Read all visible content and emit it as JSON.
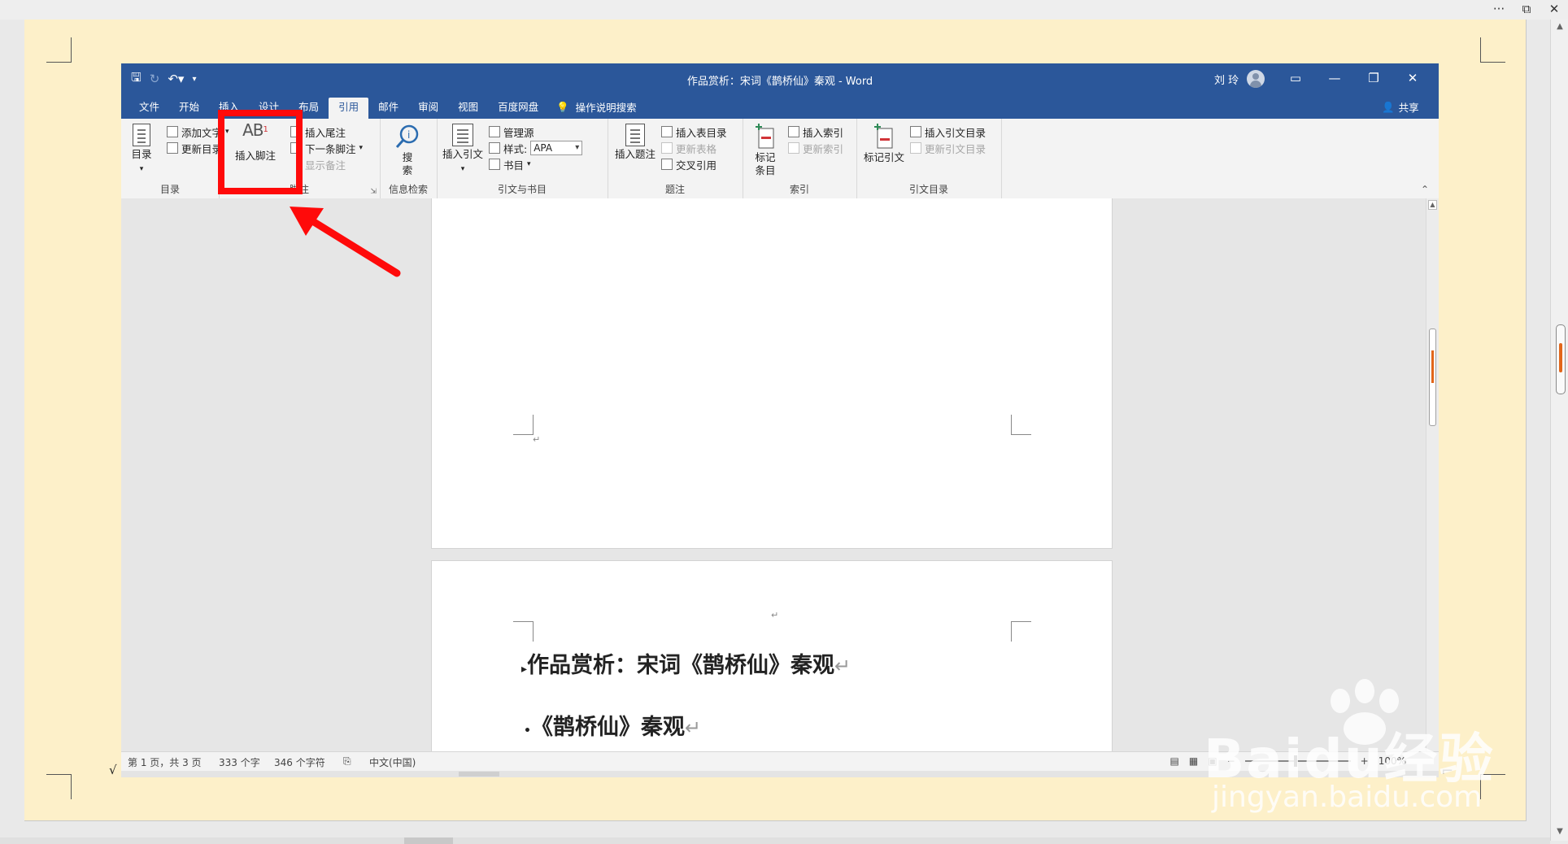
{
  "window": {
    "doc_title": "作品赏析：宋词《鹊桥仙》秦观 - Word",
    "user_name": "刘 玲"
  },
  "tabs": [
    "文件",
    "开始",
    "插入",
    "设计",
    "布局",
    "引用",
    "邮件",
    "审阅",
    "视图",
    "百度网盘"
  ],
  "active_tab": "引用",
  "tell_me": "操作说明搜索",
  "share": "共享",
  "ribbon": {
    "toc": {
      "big": "目录",
      "add_text": "添加文字",
      "update_table": "更新目录",
      "label": "目录"
    },
    "footnotes": {
      "insert_footnote": "插入脚注",
      "insert_endnote": "插入尾注",
      "next_footnote": "下一条脚注",
      "show_notes": "显示备注",
      "label": "脚注"
    },
    "research": {
      "search_top": "搜",
      "search_bottom": "索",
      "label": "信息检索"
    },
    "citations": {
      "insert_citation": "插入引文",
      "manage_sources": "管理源",
      "style_label": "样式:",
      "style_value": "APA",
      "bibliography": "书目",
      "label": "引文与书目"
    },
    "captions": {
      "insert_caption": "插入题注",
      "insert_tof": "插入表目录",
      "update_table": "更新表格",
      "cross_ref": "交叉引用",
      "label": "题注"
    },
    "index": {
      "mark_entry_top": "标记",
      "mark_entry_bottom": "条目",
      "insert_index": "插入索引",
      "update_index": "更新索引",
      "label": "索引"
    },
    "toa": {
      "mark_citation": "标记引文",
      "insert_toa": "插入引文目录",
      "update_toa": "更新引文目录",
      "label": "引文目录"
    }
  },
  "document": {
    "heading1": "作品赏析：宋词《鹊桥仙》秦观",
    "heading2": "《鹊桥仙》秦观",
    "para_mark": "↵"
  },
  "status": {
    "page": "第 1 页，共 3 页",
    "words": "333 个字",
    "chars": "346 个字符",
    "lang": "中文(中国)",
    "zoom": "100%"
  },
  "watermark": {
    "main": "Baidu经验",
    "sub": "jingyan.baidu.com"
  },
  "colors": {
    "word_blue": "#2b579a",
    "highlight_red": "#ff0a0a",
    "outer_page": "#fdf0c9"
  }
}
